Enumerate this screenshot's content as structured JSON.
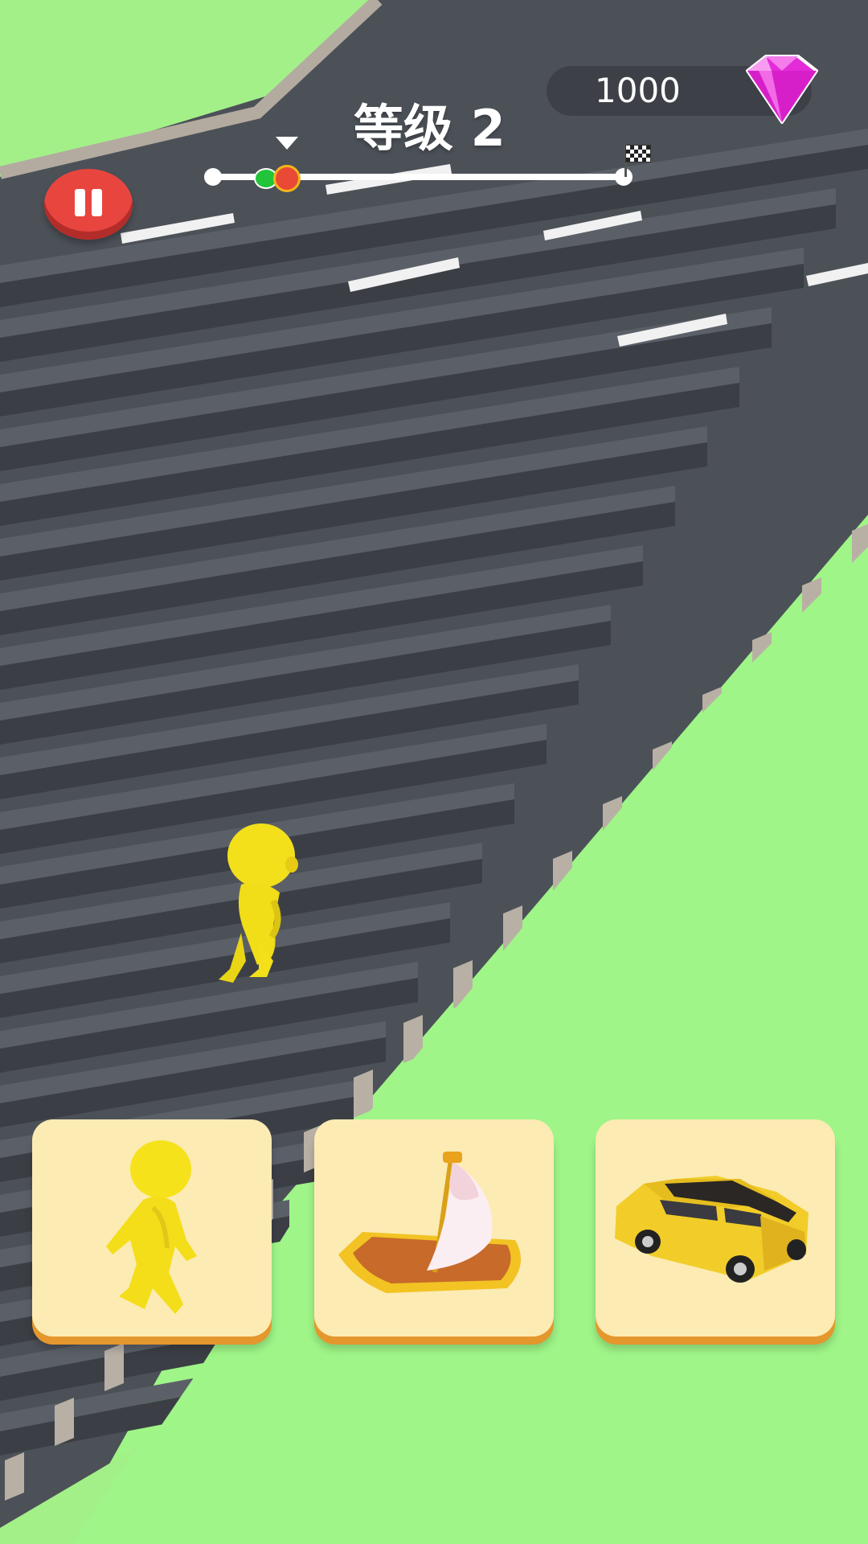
{
  "hud": {
    "level_label": "等级 2",
    "gems": "1000",
    "gem_icon": "diamond-icon",
    "pause_icon": "pause-icon",
    "finish_icon": "checkered-flag-icon"
  },
  "progress": {
    "player_fraction": 0.18,
    "rival_fraction": 0.13
  },
  "vehicles": [
    {
      "name": "runner",
      "icon": "stickman-icon"
    },
    {
      "name": "boat",
      "icon": "sailboat-icon"
    },
    {
      "name": "car",
      "icon": "car-icon"
    }
  ],
  "colors": {
    "grass": "#9ff587",
    "road": "#4e535b",
    "player": "#f6e21a",
    "pause": "#e8453f",
    "card": "#fcebb3",
    "gem": "#e42bd8"
  }
}
